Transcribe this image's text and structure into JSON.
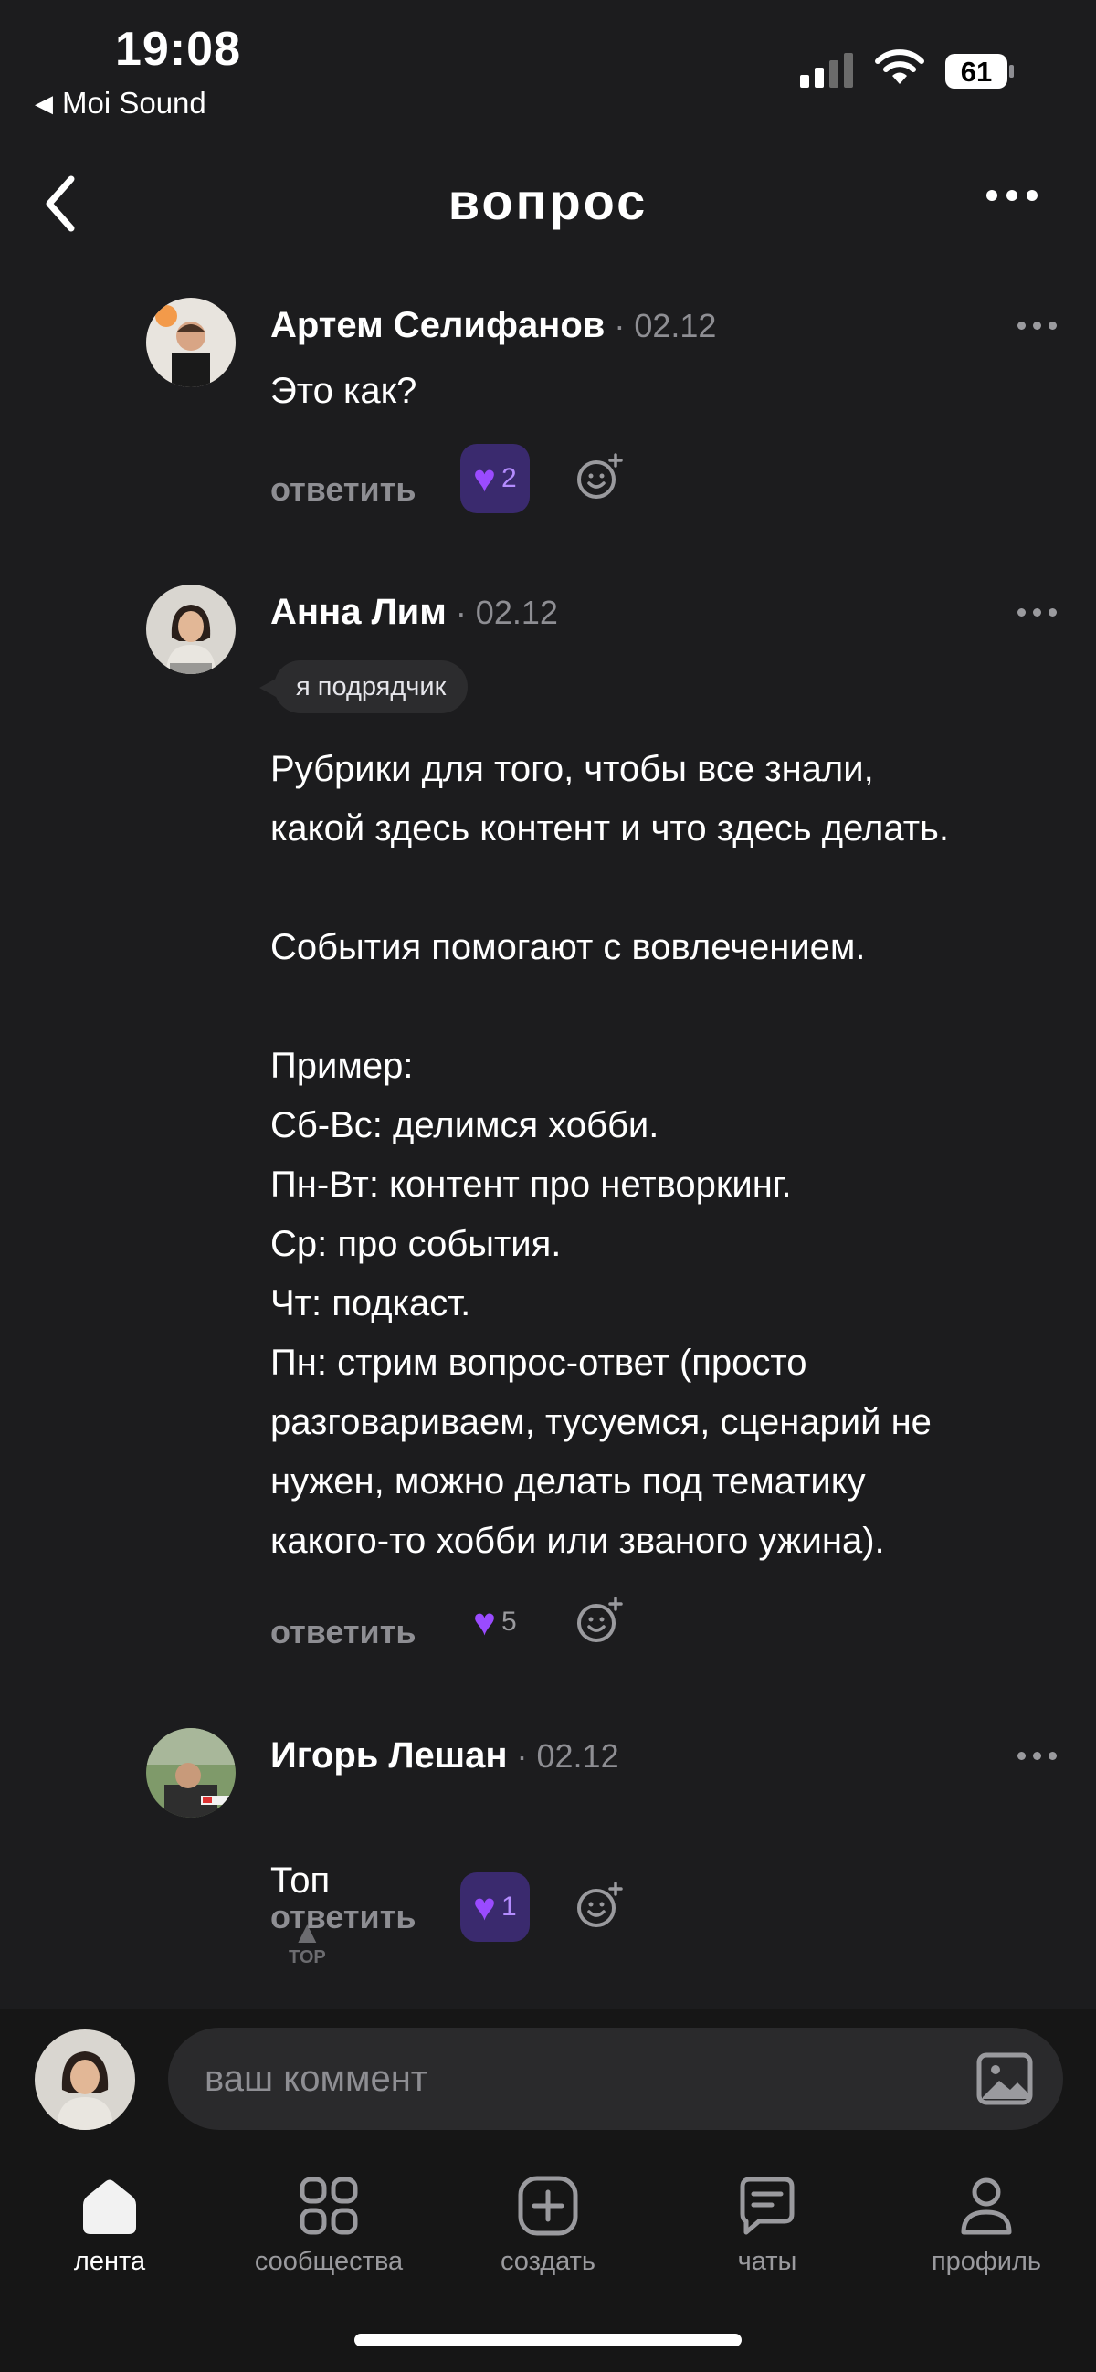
{
  "status_bar": {
    "time": "19:08",
    "back_app": "Moi Sound",
    "battery": "61"
  },
  "header": {
    "title": "вопрос"
  },
  "comments": [
    {
      "author": "Артем Селифанов",
      "date": "· 02.12",
      "text": "Это как?",
      "reply_label": "ответить",
      "likes": "2"
    },
    {
      "author": "Анна Лим",
      "date": "· 02.12",
      "badge": "я подрядчик",
      "text": "Рубрики для того, чтобы все знали,\nкакой здесь контент и что здесь делать.\n\nСобытия помогают с вовлечением.\n\nПример:\nСб-Вс: делимся хобби.\nПн-Вт: контент про нетворкинг.\nСр: про события.\nЧт: подкаст.\nПн: стрим вопрос-ответ (просто\nразговариваем, тусуемся, сценарий не\nнужен, можно делать под тематику\nкакого-то хобби или званого ужина).",
      "reply_label": "ответить",
      "likes": "5"
    },
    {
      "author": "Игорь Лешан",
      "date": "· 02.12",
      "text": "Топ",
      "top_label": "TOP",
      "reply_label": "ответить",
      "likes": "1"
    }
  ],
  "composer": {
    "placeholder": "ваш коммент"
  },
  "tabbar": {
    "tabs": [
      {
        "label": "лента",
        "icon": "home-icon"
      },
      {
        "label": "сообщества",
        "icon": "grid-icon"
      },
      {
        "label": "создать",
        "icon": "plus-square-icon"
      },
      {
        "label": "чаты",
        "icon": "chat-icon"
      },
      {
        "label": "профиль",
        "icon": "person-icon"
      }
    ]
  },
  "colors": {
    "background": "#1c1c1e",
    "accent": "#9a4bff",
    "muted": "#8e8e93"
  }
}
